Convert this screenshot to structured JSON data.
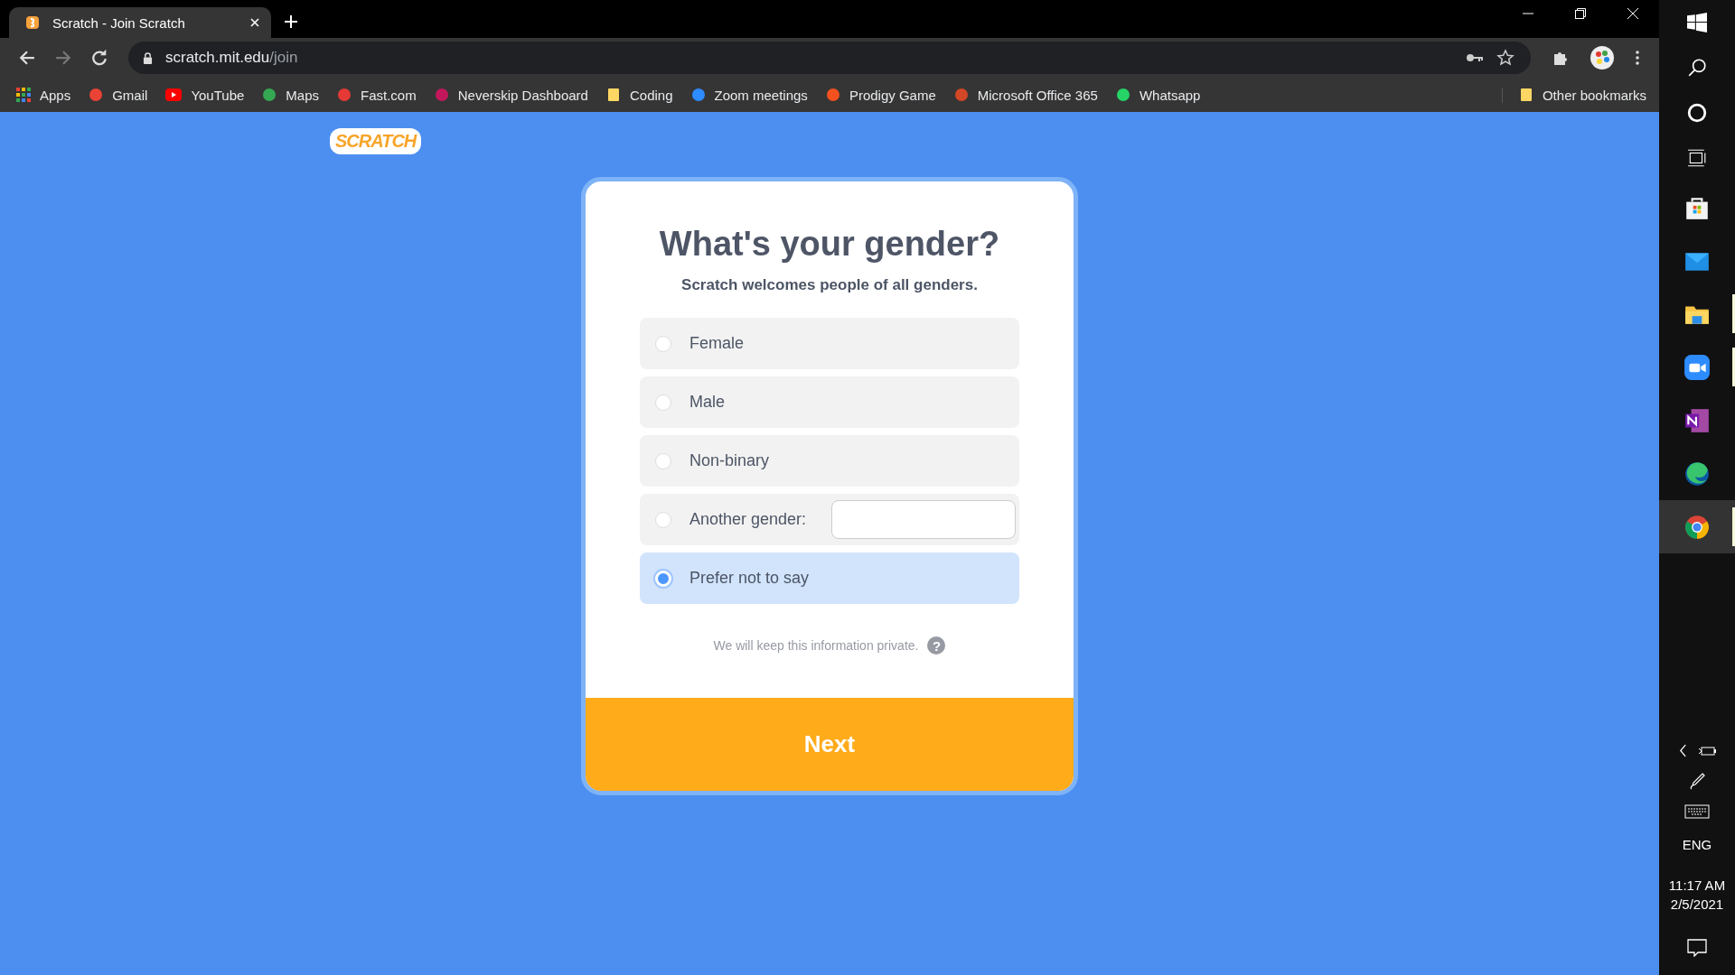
{
  "browser": {
    "tabs": [
      {
        "title": "Scratch - Join Scratch",
        "selected": true
      }
    ],
    "address": {
      "host": "scratch.mit.edu",
      "path": "/join"
    },
    "bookmarks": [
      {
        "label": "Apps"
      },
      {
        "label": "Gmail"
      },
      {
        "label": "YouTube"
      },
      {
        "label": "Maps"
      },
      {
        "label": "Fast.com"
      },
      {
        "label": "Neverskip Dashboard"
      },
      {
        "label": "Coding"
      },
      {
        "label": "Zoom meetings"
      },
      {
        "label": "Prodigy Game"
      },
      {
        "label": "Microsoft Office 365"
      },
      {
        "label": "Whatsapp"
      }
    ],
    "other_bookmarks": "Other bookmarks"
  },
  "page": {
    "logo": "SCRATCH",
    "title": "What's your gender?",
    "subtitle": "Scratch welcomes people of all genders.",
    "options": [
      {
        "label": "Female",
        "kind": "radio",
        "selected": false
      },
      {
        "label": "Male",
        "kind": "radio",
        "selected": false
      },
      {
        "label": "Non-binary",
        "kind": "radio",
        "selected": false
      },
      {
        "label": "Another gender:",
        "kind": "radio_with_field",
        "selected": false
      },
      {
        "label": "Prefer not to say",
        "kind": "radio",
        "selected": true
      }
    ],
    "privacy_note": "We will keep this information private.",
    "help": "?",
    "next_button": "Next"
  },
  "taskbar": {
    "apps": [
      {
        "running": false,
        "selected": false
      },
      {
        "running": false,
        "selected": false
      },
      {
        "running": true,
        "selected": false
      },
      {
        "running": true,
        "selected": false
      },
      {
        "running": false,
        "selected": false
      },
      {
        "running": false,
        "selected": false
      },
      {
        "running": true,
        "selected": true
      }
    ],
    "language": "ENG",
    "time": "11:17 AM",
    "date": "2/5/2021"
  }
}
